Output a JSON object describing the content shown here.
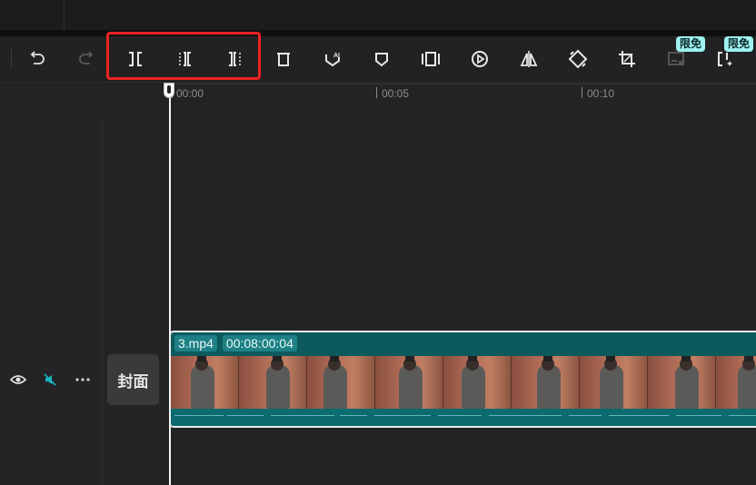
{
  "toolbar": {
    "items": [
      {
        "name": "undo-button",
        "icon": "undo-icon"
      },
      {
        "name": "redo-button",
        "icon": "redo-icon"
      },
      {
        "name": "split-button",
        "icon": "split-icon"
      },
      {
        "name": "trim-left-button",
        "icon": "trim-left-icon"
      },
      {
        "name": "trim-right-button",
        "icon": "trim-right-icon"
      },
      {
        "name": "delete-button",
        "icon": "delete-icon"
      },
      {
        "name": "ai-marker-button",
        "icon": "ai-marker-icon"
      },
      {
        "name": "marker-button",
        "icon": "marker-icon"
      },
      {
        "name": "freeze-frame-button",
        "icon": "freeze-frame-icon"
      },
      {
        "name": "reverse-button",
        "icon": "reverse-icon"
      },
      {
        "name": "mirror-button",
        "icon": "mirror-icon"
      },
      {
        "name": "rotate-button",
        "icon": "rotate-icon"
      },
      {
        "name": "crop-button",
        "icon": "crop-icon"
      },
      {
        "name": "remove-subtitle-button",
        "icon": "remove-subtitle-icon"
      },
      {
        "name": "smart-split-button",
        "icon": "smart-split-icon"
      }
    ],
    "badges": [
      "限免",
      "限免"
    ]
  },
  "ruler": {
    "labels": [
      "00:00",
      "00:05",
      "00:10"
    ]
  },
  "track": {
    "cover_label": "封面",
    "clip_name": "3.mp4",
    "clip_duration": "00:08:00:04"
  },
  "colors": {
    "highlight": "#f02323",
    "clip": "#0d5a5c",
    "badge": "#9ff3f0"
  }
}
